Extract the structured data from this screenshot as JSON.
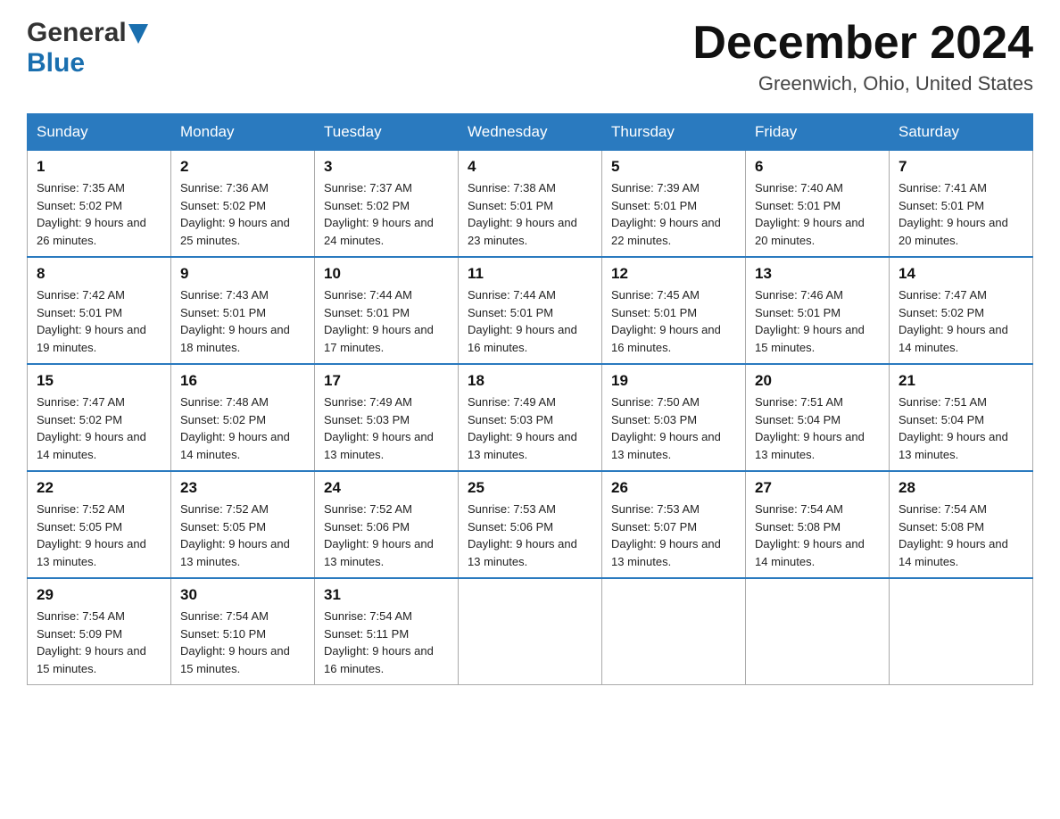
{
  "header": {
    "logo_general": "General",
    "logo_blue": "Blue",
    "month_title": "December 2024",
    "location": "Greenwich, Ohio, United States"
  },
  "days_of_week": [
    "Sunday",
    "Monday",
    "Tuesday",
    "Wednesday",
    "Thursday",
    "Friday",
    "Saturday"
  ],
  "weeks": [
    [
      {
        "day": "1",
        "sunrise": "7:35 AM",
        "sunset": "5:02 PM",
        "daylight": "9 hours and 26 minutes."
      },
      {
        "day": "2",
        "sunrise": "7:36 AM",
        "sunset": "5:02 PM",
        "daylight": "9 hours and 25 minutes."
      },
      {
        "day": "3",
        "sunrise": "7:37 AM",
        "sunset": "5:02 PM",
        "daylight": "9 hours and 24 minutes."
      },
      {
        "day": "4",
        "sunrise": "7:38 AM",
        "sunset": "5:01 PM",
        "daylight": "9 hours and 23 minutes."
      },
      {
        "day": "5",
        "sunrise": "7:39 AM",
        "sunset": "5:01 PM",
        "daylight": "9 hours and 22 minutes."
      },
      {
        "day": "6",
        "sunrise": "7:40 AM",
        "sunset": "5:01 PM",
        "daylight": "9 hours and 20 minutes."
      },
      {
        "day": "7",
        "sunrise": "7:41 AM",
        "sunset": "5:01 PM",
        "daylight": "9 hours and 20 minutes."
      }
    ],
    [
      {
        "day": "8",
        "sunrise": "7:42 AM",
        "sunset": "5:01 PM",
        "daylight": "9 hours and 19 minutes."
      },
      {
        "day": "9",
        "sunrise": "7:43 AM",
        "sunset": "5:01 PM",
        "daylight": "9 hours and 18 minutes."
      },
      {
        "day": "10",
        "sunrise": "7:44 AM",
        "sunset": "5:01 PM",
        "daylight": "9 hours and 17 minutes."
      },
      {
        "day": "11",
        "sunrise": "7:44 AM",
        "sunset": "5:01 PM",
        "daylight": "9 hours and 16 minutes."
      },
      {
        "day": "12",
        "sunrise": "7:45 AM",
        "sunset": "5:01 PM",
        "daylight": "9 hours and 16 minutes."
      },
      {
        "day": "13",
        "sunrise": "7:46 AM",
        "sunset": "5:01 PM",
        "daylight": "9 hours and 15 minutes."
      },
      {
        "day": "14",
        "sunrise": "7:47 AM",
        "sunset": "5:02 PM",
        "daylight": "9 hours and 14 minutes."
      }
    ],
    [
      {
        "day": "15",
        "sunrise": "7:47 AM",
        "sunset": "5:02 PM",
        "daylight": "9 hours and 14 minutes."
      },
      {
        "day": "16",
        "sunrise": "7:48 AM",
        "sunset": "5:02 PM",
        "daylight": "9 hours and 14 minutes."
      },
      {
        "day": "17",
        "sunrise": "7:49 AM",
        "sunset": "5:03 PM",
        "daylight": "9 hours and 13 minutes."
      },
      {
        "day": "18",
        "sunrise": "7:49 AM",
        "sunset": "5:03 PM",
        "daylight": "9 hours and 13 minutes."
      },
      {
        "day": "19",
        "sunrise": "7:50 AM",
        "sunset": "5:03 PM",
        "daylight": "9 hours and 13 minutes."
      },
      {
        "day": "20",
        "sunrise": "7:51 AM",
        "sunset": "5:04 PM",
        "daylight": "9 hours and 13 minutes."
      },
      {
        "day": "21",
        "sunrise": "7:51 AM",
        "sunset": "5:04 PM",
        "daylight": "9 hours and 13 minutes."
      }
    ],
    [
      {
        "day": "22",
        "sunrise": "7:52 AM",
        "sunset": "5:05 PM",
        "daylight": "9 hours and 13 minutes."
      },
      {
        "day": "23",
        "sunrise": "7:52 AM",
        "sunset": "5:05 PM",
        "daylight": "9 hours and 13 minutes."
      },
      {
        "day": "24",
        "sunrise": "7:52 AM",
        "sunset": "5:06 PM",
        "daylight": "9 hours and 13 minutes."
      },
      {
        "day": "25",
        "sunrise": "7:53 AM",
        "sunset": "5:06 PM",
        "daylight": "9 hours and 13 minutes."
      },
      {
        "day": "26",
        "sunrise": "7:53 AM",
        "sunset": "5:07 PM",
        "daylight": "9 hours and 13 minutes."
      },
      {
        "day": "27",
        "sunrise": "7:54 AM",
        "sunset": "5:08 PM",
        "daylight": "9 hours and 14 minutes."
      },
      {
        "day": "28",
        "sunrise": "7:54 AM",
        "sunset": "5:08 PM",
        "daylight": "9 hours and 14 minutes."
      }
    ],
    [
      {
        "day": "29",
        "sunrise": "7:54 AM",
        "sunset": "5:09 PM",
        "daylight": "9 hours and 15 minutes."
      },
      {
        "day": "30",
        "sunrise": "7:54 AM",
        "sunset": "5:10 PM",
        "daylight": "9 hours and 15 minutes."
      },
      {
        "day": "31",
        "sunrise": "7:54 AM",
        "sunset": "5:11 PM",
        "daylight": "9 hours and 16 minutes."
      },
      null,
      null,
      null,
      null
    ]
  ]
}
